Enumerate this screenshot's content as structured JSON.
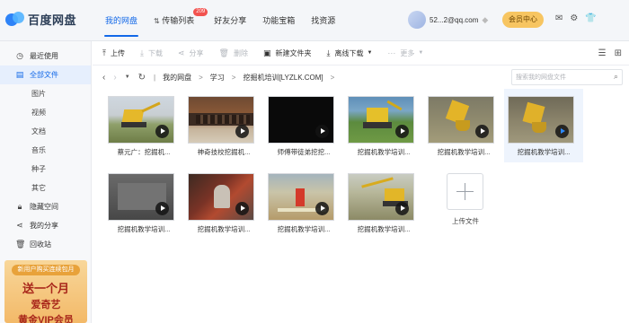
{
  "app": {
    "logo_text": "百度网盘"
  },
  "nav": {
    "items": [
      "我的网盘",
      "传输列表",
      "好友分享",
      "功能宝箱",
      "找资源"
    ],
    "transfer_badge": "209"
  },
  "user": {
    "name": "52...2@qq.com",
    "vip_button": "会员中心"
  },
  "sidebar": {
    "items": [
      "最近使用",
      "全部文件"
    ],
    "sub_items": [
      "图片",
      "视频",
      "文档",
      "音乐",
      "种子",
      "其它"
    ],
    "bottom_items": [
      "隐藏空间",
      "我的分享",
      "回收站"
    ],
    "promo": {
      "tag": "新用户购买连续包月",
      "line1": "送一个月",
      "line2": "爱奇艺",
      "line3": "黄金VIP会员"
    }
  },
  "toolbar": {
    "items": [
      {
        "label": "上传",
        "icon": "upload-icon",
        "enabled": true
      },
      {
        "label": "下载",
        "icon": "download-icon",
        "enabled": false
      },
      {
        "label": "分享",
        "icon": "share-icon",
        "enabled": false
      },
      {
        "label": "删除",
        "icon": "delete-icon",
        "enabled": false
      },
      {
        "label": "新建文件夹",
        "icon": "new-folder-icon",
        "enabled": true
      },
      {
        "label": "离线下载",
        "icon": "offline-download-icon",
        "enabled": true
      },
      {
        "label": "更多",
        "icon": "more-icon",
        "enabled": false
      }
    ]
  },
  "breadcrumb": {
    "items": [
      "我的网盘",
      "学习",
      "挖掘机培训[LYZLK.COM]"
    ],
    "search_placeholder": "搜索我的网盘文件"
  },
  "files": [
    {
      "name": "蔡元广：挖掘机...",
      "thumb": "video-yellow-excavator-field",
      "selected": false
    },
    {
      "name": "神奇技校挖掘机...",
      "thumb": "video-tracks-closeup",
      "selected": false
    },
    {
      "name": "师傅带徒弟挖挖...",
      "thumb": "video-black-frame",
      "selected": false
    },
    {
      "name": "挖掘机教学培训...",
      "thumb": "video-animated-excavator",
      "selected": false
    },
    {
      "name": "挖掘机教学培训...",
      "thumb": "video-bucket-digging",
      "selected": false
    },
    {
      "name": "挖掘机教学培训...",
      "thumb": "video-bucket-digging-2",
      "selected": true
    },
    {
      "name": "挖掘机教学培训...",
      "thumb": "video-gray-cab",
      "selected": false
    },
    {
      "name": "挖掘机教学培训...",
      "thumb": "video-operator-cab",
      "selected": false
    },
    {
      "name": "挖掘机教学培训...",
      "thumb": "video-training-site",
      "selected": false
    },
    {
      "name": "挖掘机教学培训...",
      "thumb": "video-excavator-slope",
      "selected": false
    }
  ],
  "upload_tile": {
    "label": "上传文件"
  },
  "colors": {
    "accent": "#1268e8",
    "badge": "#f2524f",
    "vip": "#f7c561"
  }
}
